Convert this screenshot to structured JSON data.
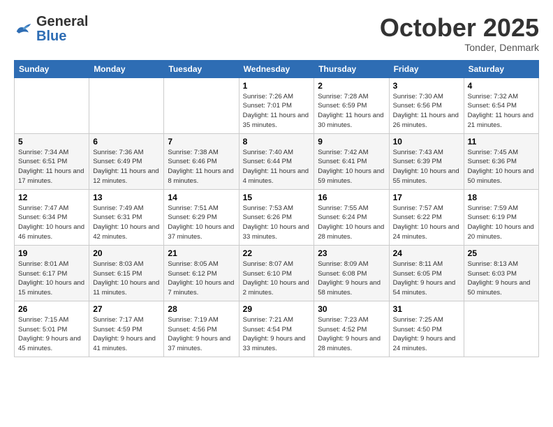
{
  "header": {
    "logo_general": "General",
    "logo_blue": "Blue",
    "month": "October 2025",
    "location": "Tonder, Denmark"
  },
  "days_of_week": [
    "Sunday",
    "Monday",
    "Tuesday",
    "Wednesday",
    "Thursday",
    "Friday",
    "Saturday"
  ],
  "weeks": [
    [
      {
        "day": "",
        "info": ""
      },
      {
        "day": "",
        "info": ""
      },
      {
        "day": "",
        "info": ""
      },
      {
        "day": "1",
        "info": "Sunrise: 7:26 AM\nSunset: 7:01 PM\nDaylight: 11 hours and 35 minutes."
      },
      {
        "day": "2",
        "info": "Sunrise: 7:28 AM\nSunset: 6:59 PM\nDaylight: 11 hours and 30 minutes."
      },
      {
        "day": "3",
        "info": "Sunrise: 7:30 AM\nSunset: 6:56 PM\nDaylight: 11 hours and 26 minutes."
      },
      {
        "day": "4",
        "info": "Sunrise: 7:32 AM\nSunset: 6:54 PM\nDaylight: 11 hours and 21 minutes."
      }
    ],
    [
      {
        "day": "5",
        "info": "Sunrise: 7:34 AM\nSunset: 6:51 PM\nDaylight: 11 hours and 17 minutes."
      },
      {
        "day": "6",
        "info": "Sunrise: 7:36 AM\nSunset: 6:49 PM\nDaylight: 11 hours and 12 minutes."
      },
      {
        "day": "7",
        "info": "Sunrise: 7:38 AM\nSunset: 6:46 PM\nDaylight: 11 hours and 8 minutes."
      },
      {
        "day": "8",
        "info": "Sunrise: 7:40 AM\nSunset: 6:44 PM\nDaylight: 11 hours and 4 minutes."
      },
      {
        "day": "9",
        "info": "Sunrise: 7:42 AM\nSunset: 6:41 PM\nDaylight: 10 hours and 59 minutes."
      },
      {
        "day": "10",
        "info": "Sunrise: 7:43 AM\nSunset: 6:39 PM\nDaylight: 10 hours and 55 minutes."
      },
      {
        "day": "11",
        "info": "Sunrise: 7:45 AM\nSunset: 6:36 PM\nDaylight: 10 hours and 50 minutes."
      }
    ],
    [
      {
        "day": "12",
        "info": "Sunrise: 7:47 AM\nSunset: 6:34 PM\nDaylight: 10 hours and 46 minutes."
      },
      {
        "day": "13",
        "info": "Sunrise: 7:49 AM\nSunset: 6:31 PM\nDaylight: 10 hours and 42 minutes."
      },
      {
        "day": "14",
        "info": "Sunrise: 7:51 AM\nSunset: 6:29 PM\nDaylight: 10 hours and 37 minutes."
      },
      {
        "day": "15",
        "info": "Sunrise: 7:53 AM\nSunset: 6:26 PM\nDaylight: 10 hours and 33 minutes."
      },
      {
        "day": "16",
        "info": "Sunrise: 7:55 AM\nSunset: 6:24 PM\nDaylight: 10 hours and 28 minutes."
      },
      {
        "day": "17",
        "info": "Sunrise: 7:57 AM\nSunset: 6:22 PM\nDaylight: 10 hours and 24 minutes."
      },
      {
        "day": "18",
        "info": "Sunrise: 7:59 AM\nSunset: 6:19 PM\nDaylight: 10 hours and 20 minutes."
      }
    ],
    [
      {
        "day": "19",
        "info": "Sunrise: 8:01 AM\nSunset: 6:17 PM\nDaylight: 10 hours and 15 minutes."
      },
      {
        "day": "20",
        "info": "Sunrise: 8:03 AM\nSunset: 6:15 PM\nDaylight: 10 hours and 11 minutes."
      },
      {
        "day": "21",
        "info": "Sunrise: 8:05 AM\nSunset: 6:12 PM\nDaylight: 10 hours and 7 minutes."
      },
      {
        "day": "22",
        "info": "Sunrise: 8:07 AM\nSunset: 6:10 PM\nDaylight: 10 hours and 2 minutes."
      },
      {
        "day": "23",
        "info": "Sunrise: 8:09 AM\nSunset: 6:08 PM\nDaylight: 9 hours and 58 minutes."
      },
      {
        "day": "24",
        "info": "Sunrise: 8:11 AM\nSunset: 6:05 PM\nDaylight: 9 hours and 54 minutes."
      },
      {
        "day": "25",
        "info": "Sunrise: 8:13 AM\nSunset: 6:03 PM\nDaylight: 9 hours and 50 minutes."
      }
    ],
    [
      {
        "day": "26",
        "info": "Sunrise: 7:15 AM\nSunset: 5:01 PM\nDaylight: 9 hours and 45 minutes."
      },
      {
        "day": "27",
        "info": "Sunrise: 7:17 AM\nSunset: 4:59 PM\nDaylight: 9 hours and 41 minutes."
      },
      {
        "day": "28",
        "info": "Sunrise: 7:19 AM\nSunset: 4:56 PM\nDaylight: 9 hours and 37 minutes."
      },
      {
        "day": "29",
        "info": "Sunrise: 7:21 AM\nSunset: 4:54 PM\nDaylight: 9 hours and 33 minutes."
      },
      {
        "day": "30",
        "info": "Sunrise: 7:23 AM\nSunset: 4:52 PM\nDaylight: 9 hours and 28 minutes."
      },
      {
        "day": "31",
        "info": "Sunrise: 7:25 AM\nSunset: 4:50 PM\nDaylight: 9 hours and 24 minutes."
      },
      {
        "day": "",
        "info": ""
      }
    ]
  ]
}
